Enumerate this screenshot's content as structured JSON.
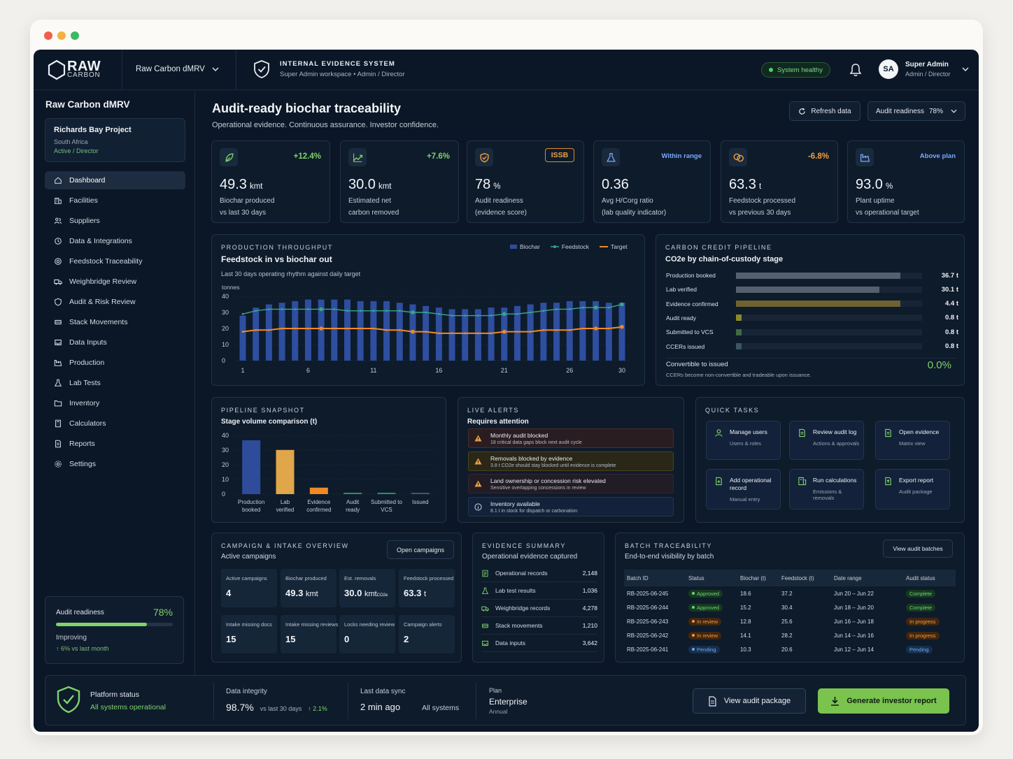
{
  "colors": {
    "accent_green": "#7ed36a",
    "accent_blue": "#2f4c9a",
    "accent_orange": "#f08a24",
    "warning": "#e3a13b"
  },
  "topbar": {
    "logo_raw": "RAW",
    "logo_carbon": "CARBON",
    "project_select": "Raw Carbon dMRV",
    "ies_title": "INTERNAL EVIDENCE SYSTEM",
    "ies_sub": "Super Admin workspace • Admin / Director",
    "health": "System healthy",
    "user_initials": "SA",
    "user_name": "Super Admin",
    "user_role": "Admin / Director"
  },
  "sidebar": {
    "title": "Raw Carbon dMRV",
    "project_name": "Richards Bay Project",
    "project_location": "South Africa",
    "project_role": "Active / Director",
    "items": [
      {
        "label": "Dashboard",
        "icon": "home-icon"
      },
      {
        "label": "Facilities",
        "icon": "building-icon"
      },
      {
        "label": "Suppliers",
        "icon": "users-icon"
      },
      {
        "label": "Data & Integrations",
        "icon": "plug-icon"
      },
      {
        "label": "Feedstock Traceability",
        "icon": "target-icon"
      },
      {
        "label": "Weighbridge Review",
        "icon": "truck-icon"
      },
      {
        "label": "Audit & Risk Review",
        "icon": "shield-icon"
      },
      {
        "label": "Stack Movements",
        "icon": "stack-icon"
      },
      {
        "label": "Data Inputs",
        "icon": "inbox-icon"
      },
      {
        "label": "Production",
        "icon": "factory-icon"
      },
      {
        "label": "Lab Tests",
        "icon": "flask-icon"
      },
      {
        "label": "Inventory",
        "icon": "folder-icon"
      },
      {
        "label": "Calculators",
        "icon": "calculator-icon"
      },
      {
        "label": "Reports",
        "icon": "report-icon"
      },
      {
        "label": "Settings",
        "icon": "gear-icon"
      }
    ],
    "readiness_label": "Audit readiness",
    "readiness_value": "78%",
    "readiness_fraction": 0.78,
    "readiness_status": "Improving",
    "readiness_delta": "↑ 6% vs last month"
  },
  "header": {
    "title": "Audit-ready biochar traceability",
    "subtitle": "Operational evidence. Continuous assurance. Investor confidence.",
    "refresh_label": "Refresh data",
    "readiness_select_label": "Audit readiness",
    "readiness_select_value": "78%"
  },
  "kpis": [
    {
      "icon": "leaf-icon",
      "badge": "+12.4%",
      "value": "49.3",
      "unit": "kmt",
      "label1": "Biochar produced",
      "label2": "vs last 30 days"
    },
    {
      "icon": "trend-up-icon",
      "badge": "+7.6%",
      "value": "30.0",
      "unit": "kmt",
      "label1": "Estimated net",
      "label2": "carbon removed"
    },
    {
      "icon": "shield-check-icon",
      "badge": "ISSB",
      "value": "78",
      "unit": "%",
      "label1": "Audit readiness",
      "label2": "(evidence score)"
    },
    {
      "icon": "flask-icon",
      "badge": "Within range",
      "value": "0.36",
      "unit": "",
      "label1": "Avg H/Corg ratio",
      "label2": "(lab quality indicator)"
    },
    {
      "icon": "coins-icon",
      "badge": "-6.8%",
      "value": "63.3",
      "unit": "t",
      "label1": "Feedstock processed",
      "label2": "vs previous 30 days"
    },
    {
      "icon": "factory-icon",
      "badge": "Above plan",
      "value": "93.0",
      "unit": "%",
      "label1": "Plant uptime",
      "label2": "vs operational target"
    }
  ],
  "throughput": {
    "label": "PRODUCTION THROUGHPUT",
    "title": "Feedstock in vs biochar out",
    "subtitle": "Last 30 days operating rhythm against daily target",
    "legend": [
      "Biochar",
      "Feedstock",
      "Target"
    ],
    "yunit": "tonnes"
  },
  "pipeline": {
    "label": "CARBON CREDIT PIPELINE",
    "title": "CO2e by chain-of-custody stage",
    "rows": [
      {
        "label": "Production booked",
        "value": "36.7 t",
        "fraction": 0.885,
        "color": "#55606e"
      },
      {
        "label": "Lab verified",
        "value": "30.1 t",
        "fraction": 0.77,
        "color": "#55606e"
      },
      {
        "label": "Evidence confirmed",
        "value": "4.4 t",
        "fraction": 0.885,
        "color": "#6e6230"
      },
      {
        "label": "Audit ready",
        "value": "0.8 t",
        "fraction": 0.03,
        "color": "#8a8a2a"
      },
      {
        "label": "Submitted to VCS",
        "value": "0.8 t",
        "fraction": 0.03,
        "color": "#3f6a44"
      },
      {
        "label": "CCERs issued",
        "value": "0.8 t",
        "fraction": 0.03,
        "color": "#3c5566"
      }
    ],
    "convertible_label": "Convertible to issued",
    "convertible_value": "0.0%",
    "note": "CCERs become non-convertible and tradeable upon issuance."
  },
  "snapshot": {
    "label": "PIPELINE SNAPSHOT",
    "title": "Stage volume comparison (t)"
  },
  "alerts": {
    "label": "LIVE ALERTS",
    "title": "Requires attention",
    "items": [
      {
        "title": "Monthly audit blocked",
        "sub": "18 critical data gaps block next audit cycle",
        "kind": "danger"
      },
      {
        "title": "Removals blocked by evidence",
        "sub": "3.8 t CO2e should stay blocked until evidence is complete",
        "kind": "warning"
      },
      {
        "title": "Land ownership or concession risk elevated",
        "sub": "Sensitive overlapping concessions in review",
        "kind": "danger2"
      },
      {
        "title": "Inventory available",
        "sub": "8.1 t in stock for dispatch or carbonation",
        "kind": "info"
      }
    ]
  },
  "tasks": {
    "label": "QUICK TASKS",
    "items": [
      {
        "title": "Manage users",
        "sub": "Users & roles",
        "icon": "user-icon"
      },
      {
        "title": "Review audit log",
        "sub": "Actions & approvals",
        "icon": "document-icon"
      },
      {
        "title": "Open evidence",
        "sub": "Matrix view",
        "icon": "document-icon"
      },
      {
        "title": "Add operational record",
        "sub": "Manual entry",
        "icon": "document-plus-icon"
      },
      {
        "title": "Run calculations",
        "sub": "Emissions & removals",
        "icon": "calculator-doc-icon"
      },
      {
        "title": "Export report",
        "sub": "Audit package",
        "icon": "export-icon"
      }
    ]
  },
  "campaign": {
    "label": "CAMPAIGN & INTAKE OVERVIEW",
    "title": "Active campaigns",
    "button": "Open campaigns",
    "minis": [
      {
        "label": "Active campaigns",
        "value": "4",
        "unit": ""
      },
      {
        "label": "Biochar produced",
        "value": "49.3",
        "unit": "kmt"
      },
      {
        "label": "Est. removals",
        "value": "30.0",
        "unit": "kmt",
        "unit2": "CO2e"
      },
      {
        "label": "Feedstock processed",
        "value": "63.3",
        "unit": "t"
      },
      {
        "label": "Intake missing docs",
        "value": "15",
        "unit": ""
      },
      {
        "label": "Intake missing reviews",
        "value": "15",
        "unit": ""
      },
      {
        "label": "Locks needing review",
        "value": "0",
        "unit": ""
      },
      {
        "label": "Campaign alerts",
        "value": "2",
        "unit": ""
      }
    ]
  },
  "evidence": {
    "label": "EVIDENCE SUMMARY",
    "title": "Operational evidence captured",
    "rows": [
      {
        "label": "Operational records",
        "value": "2,148",
        "icon": "records-icon"
      },
      {
        "label": "Lab test results",
        "value": "1,036",
        "icon": "flask-icon"
      },
      {
        "label": "Weighbridge records",
        "value": "4,278",
        "icon": "truck-icon"
      },
      {
        "label": "Stack movements",
        "value": "1,210",
        "icon": "stack-icon"
      },
      {
        "label": "Data inputs",
        "value": "3,642",
        "icon": "inbox-icon"
      }
    ]
  },
  "batches": {
    "label": "BATCH TRACEABILITY",
    "title": "End-to-end visibility by batch",
    "button": "View audit batches",
    "headers": [
      "Batch ID",
      "Status",
      "Biochar (t)",
      "Feedstock (t)",
      "Date range",
      "Audit status"
    ],
    "rows": [
      {
        "id": "RB-2025-06-245",
        "status": "Approved",
        "s": "green",
        "biochar": "18.6",
        "feedstock": "37.2",
        "range": "Jun 20 – Jun 22",
        "audit": "Complete",
        "a": "green"
      },
      {
        "id": "RB-2025-06-244",
        "status": "Approved",
        "s": "green",
        "biochar": "15.2",
        "feedstock": "30.4",
        "range": "Jun 18 – Jun 20",
        "audit": "Complete",
        "a": "green"
      },
      {
        "id": "RB-2025-06-243",
        "status": "In review",
        "s": "orange",
        "biochar": "12.8",
        "feedstock": "25.6",
        "range": "Jun 16 – Jun 18",
        "audit": "In progress",
        "a": "orange"
      },
      {
        "id": "RB-2025-06-242",
        "status": "In review",
        "s": "orange",
        "biochar": "14.1",
        "feedstock": "28.2",
        "range": "Jun 14 – Jun 16",
        "audit": "In progress",
        "a": "orange"
      },
      {
        "id": "RB-2025-06-241",
        "status": "Pending",
        "s": "blue",
        "biochar": "10.3",
        "feedstock": "20.6",
        "range": "Jun 12 – Jun 14",
        "audit": "Pending",
        "a": "blue"
      }
    ]
  },
  "footer": {
    "status_label": "Platform status",
    "status_value": "All systems operational",
    "integrity_label": "Data integrity",
    "integrity_value": "98.7%",
    "integrity_sub": "vs last 30 days",
    "integrity_delta": "↑ 2.1%",
    "sync_label": "Last data sync",
    "sync_value": "2 min ago",
    "sync_scope": "All systems",
    "plan_label": "Plan",
    "plan_value": "Enterprise",
    "plan_sub": "Annual",
    "view_button": "View audit package",
    "generate_button": "Generate investor report"
  },
  "chart_data": [
    {
      "type": "bar",
      "title": "Feedstock in vs biochar out",
      "ylabel": "tonnes",
      "ylim": [
        0,
        40
      ],
      "yticks": [
        0,
        10,
        20,
        30,
        40
      ],
      "xticks": [
        1,
        6,
        11,
        16,
        21,
        26,
        30
      ],
      "x": [
        1,
        2,
        3,
        4,
        5,
        6,
        7,
        8,
        9,
        10,
        11,
        12,
        13,
        14,
        15,
        16,
        17,
        18,
        19,
        20,
        21,
        22,
        23,
        24,
        25,
        26,
        27,
        28,
        29,
        30
      ],
      "series": [
        {
          "name": "Biochar",
          "kind": "bar",
          "values": [
            28,
            33,
            35,
            36,
            37,
            38,
            38,
            38,
            38,
            37,
            37,
            37,
            36,
            35,
            34,
            33,
            32,
            32,
            32,
            33,
            33,
            34,
            35,
            36,
            36,
            37,
            37,
            37,
            36,
            36
          ]
        },
        {
          "name": "Feedstock",
          "kind": "line",
          "values": [
            29,
            31,
            32,
            32,
            32,
            32,
            32,
            32,
            31,
            31,
            31,
            31,
            31,
            30,
            30,
            29,
            28,
            28,
            28,
            28,
            29,
            29,
            30,
            31,
            32,
            32,
            33,
            33,
            33,
            35
          ]
        },
        {
          "name": "Target",
          "kind": "line",
          "values": [
            18,
            19,
            19,
            20,
            20,
            20,
            20,
            20,
            20,
            20,
            20,
            19,
            19,
            18,
            18,
            17,
            17,
            17,
            17,
            17,
            18,
            18,
            18,
            19,
            19,
            19,
            20,
            20,
            20,
            21
          ]
        }
      ],
      "legend": "top-right",
      "grid": true
    },
    {
      "type": "bar",
      "title": "Stage volume comparison (t)",
      "categories": [
        "Production booked",
        "Lab verified",
        "Evidence confirmed",
        "Audit ready",
        "Submitted to VCS",
        "Issued"
      ],
      "values": [
        36.7,
        30.1,
        4.4,
        0.8,
        0.8,
        0.8
      ],
      "colors": [
        "#2f4c9a",
        "#e0a64a",
        "#f08a24",
        "#2e8f5a",
        "#2e8f5a",
        "#45566a"
      ],
      "ylim": [
        0,
        40
      ],
      "yticks": [
        0,
        10,
        20,
        30,
        40
      ],
      "grid": true
    }
  ]
}
